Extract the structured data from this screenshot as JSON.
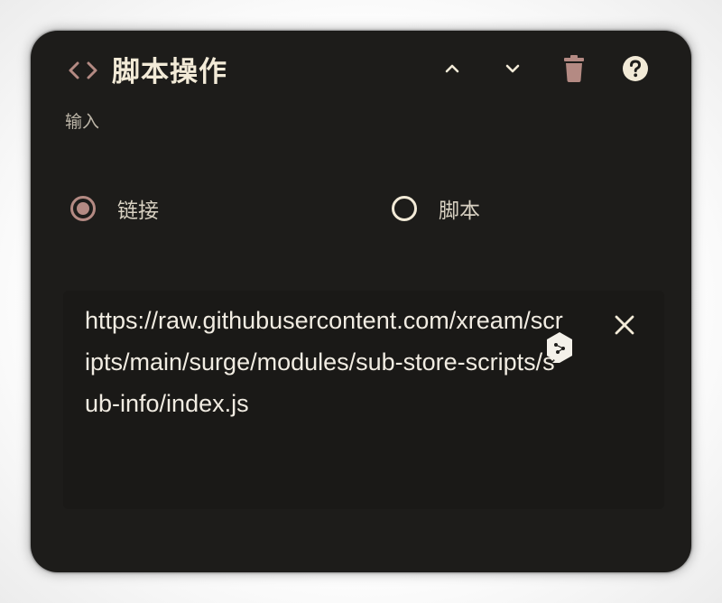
{
  "header": {
    "title": "脚本操作",
    "icon": "code-brackets-icon",
    "controls": [
      "chevron-up-icon",
      "chevron-down-icon",
      "trash-icon",
      "help-icon"
    ]
  },
  "input_section": {
    "label": "输入"
  },
  "mode": {
    "options": [
      {
        "label": "链接",
        "selected": true
      },
      {
        "label": "脚本",
        "selected": false
      }
    ]
  },
  "url_field": {
    "value": "https://raw.githubusercontent.com/xream/scripts/main/surge/modules/sub-store-scripts/sub-info/index.js",
    "clear_icon": "close-icon"
  },
  "colors": {
    "card_bg": "#1d1c1a",
    "accent": "#b48a83",
    "text_primary": "#f2ead7",
    "text_secondary": "#bdb6a8"
  }
}
